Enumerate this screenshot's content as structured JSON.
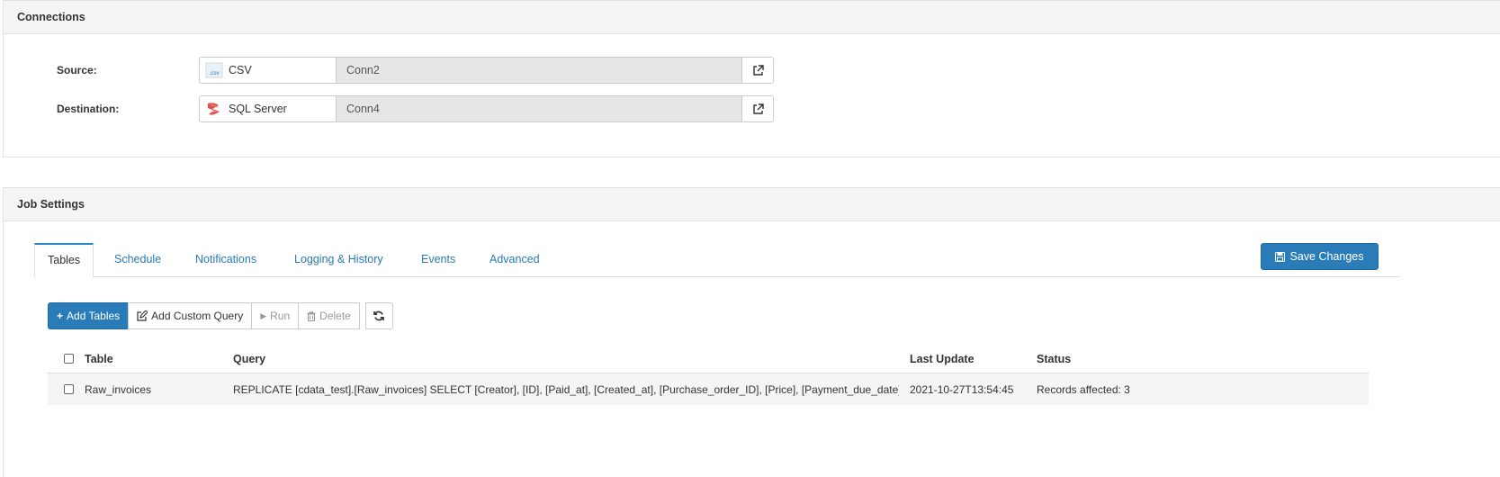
{
  "connections": {
    "title": "Connections",
    "source": {
      "label": "Source:",
      "type": "CSV",
      "type_icon_text": ".csv",
      "name": "Conn2"
    },
    "destination": {
      "label": "Destination:",
      "type": "SQL Server",
      "name": "Conn4"
    }
  },
  "job_settings": {
    "title": "Job Settings",
    "tabs": [
      {
        "label": "Tables"
      },
      {
        "label": "Schedule"
      },
      {
        "label": "Notifications"
      },
      {
        "label": "Logging & History"
      },
      {
        "label": "Events"
      },
      {
        "label": "Advanced"
      }
    ],
    "save_label": "Save Changes",
    "toolbar": {
      "add_tables": "Add Tables",
      "add_custom_query": "Add Custom Query",
      "run": "Run",
      "delete": "Delete"
    },
    "table": {
      "columns": [
        "Table",
        "Query",
        "Last Update",
        "Status"
      ],
      "rows": [
        {
          "table": "Raw_invoices",
          "query": "REPLICATE [cdata_test].[Raw_invoices] SELECT [Creator], [ID], [Paid_at], [Created_at], [Purchase_order_ID], [Price], [Payment_due_date] FR...",
          "last_update": "2021-10-27T13:54:45",
          "status": "Records affected: 3"
        }
      ]
    }
  },
  "colors": {
    "accent": "#2a7cb8",
    "link": "#2a7ab8",
    "panel_header": "#f5f5f5"
  }
}
